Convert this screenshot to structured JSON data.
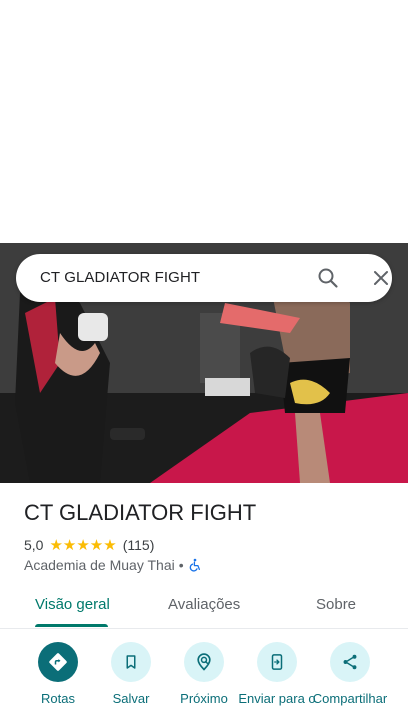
{
  "search": {
    "query": "CT GLADIATOR FIGHT"
  },
  "place": {
    "name": "CT GLADIATOR FIGHT",
    "rating": "5,0",
    "stars": "★★★★★",
    "review_count": "(115)",
    "category": "Academia de Muay Thai",
    "separator": "•"
  },
  "tabs": [
    {
      "label": "Visão geral"
    },
    {
      "label": "Avaliações"
    },
    {
      "label": "Sobre"
    }
  ],
  "actions": [
    {
      "label": "Rotas",
      "icon": "directions-icon"
    },
    {
      "label": "Salvar",
      "icon": "bookmark-icon"
    },
    {
      "label": "Próximo",
      "icon": "nearby-icon"
    },
    {
      "label": "Enviar para o",
      "icon": "send-to-phone-icon"
    },
    {
      "label": "Compartilhar",
      "icon": "share-icon"
    }
  ],
  "colors": {
    "accent": "#0b6e78",
    "tab_active": "#00796b",
    "star": "#fbbc04"
  }
}
